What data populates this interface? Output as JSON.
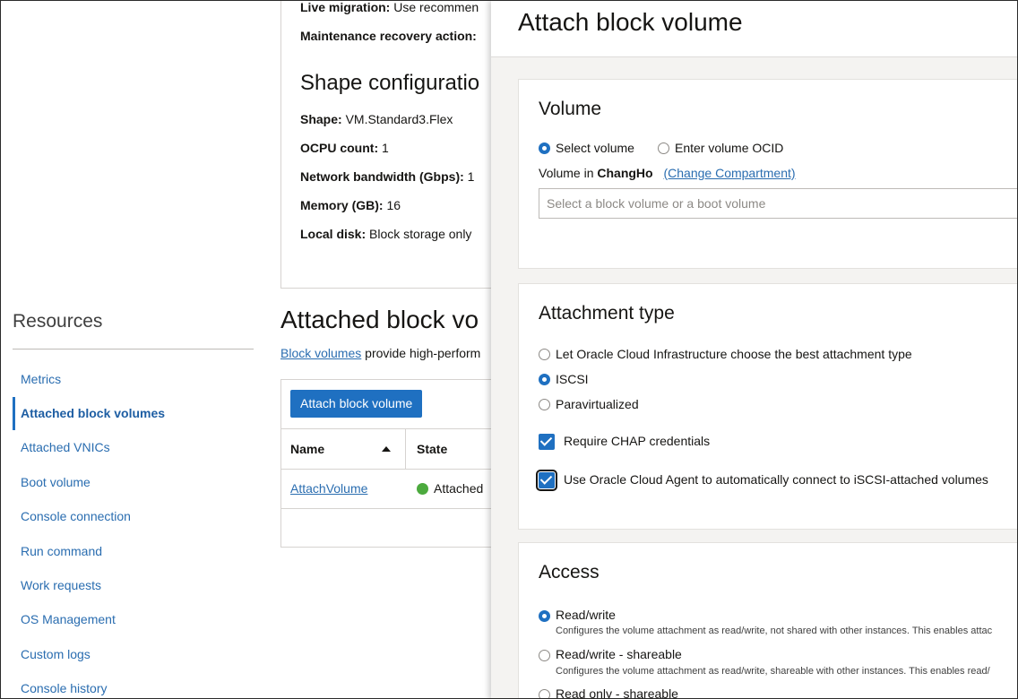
{
  "background": {
    "details": {
      "live_migration_label": "Live migration:",
      "live_migration_value": "Use recommen",
      "maintenance_label": "Maintenance recovery action:",
      "shape_heading": "Shape configuratio",
      "shape_label": "Shape:",
      "shape_value": "VM.Standard3.Flex",
      "ocpu_label": "OCPU count:",
      "ocpu_value": "1",
      "bandwidth_label": "Network bandwidth (Gbps):",
      "bandwidth_value": "1",
      "memory_label": "Memory (GB):",
      "memory_value": "16",
      "local_disk_label": "Local disk:",
      "local_disk_value": "Block storage only"
    },
    "attached": {
      "heading": "Attached block vo",
      "desc_link": "Block volumes",
      "desc_text": "provide high-perform",
      "attach_button": "Attach block volume",
      "columns": [
        "Name",
        "State"
      ],
      "rows": [
        {
          "name": "AttachVolume",
          "state": "Attached"
        }
      ]
    },
    "resources": {
      "title": "Resources",
      "items": [
        {
          "label": "Metrics"
        },
        {
          "label": "Attached block volumes"
        },
        {
          "label": "Attached VNICs"
        },
        {
          "label": "Boot volume"
        },
        {
          "label": "Console connection"
        },
        {
          "label": "Run command"
        },
        {
          "label": "Work requests"
        },
        {
          "label": "OS Management"
        },
        {
          "label": "Custom logs"
        },
        {
          "label": "Console history"
        }
      ],
      "active": "Attached block volumes"
    }
  },
  "panel": {
    "title": "Attach block volume",
    "volume": {
      "heading": "Volume",
      "options": [
        "Select volume",
        "Enter volume OCID"
      ],
      "selected": "Select volume",
      "compartment_prefix": "Volume in",
      "compartment_name": "ChangHo",
      "change_link": "(Change Compartment)",
      "select_placeholder": "Select a block volume or a boot volume"
    },
    "attachment": {
      "heading": "Attachment type",
      "options": [
        "Let Oracle Cloud Infrastructure choose the best attachment type",
        "ISCSI",
        "Paravirtualized"
      ],
      "selected": "ISCSI",
      "chap_label": "Require CHAP credentials",
      "chap_checked": true,
      "agent_label": "Use Oracle Cloud Agent to automatically connect to iSCSI-attached volumes",
      "agent_checked": true
    },
    "access": {
      "heading": "Access",
      "options": [
        {
          "label": "Read/write",
          "desc": "Configures the volume attachment as read/write, not shared with other instances. This enables attac"
        },
        {
          "label": "Read/write - shareable",
          "desc": "Configures the volume attachment as read/write, shareable with other instances. This enables read/"
        },
        {
          "label": "Read only - shareable",
          "desc": ""
        }
      ],
      "selected": "Read/write"
    }
  },
  "colors": {
    "accent": "#1f70c1",
    "link": "#2a6db0",
    "status_green": "#4caa3e"
  }
}
